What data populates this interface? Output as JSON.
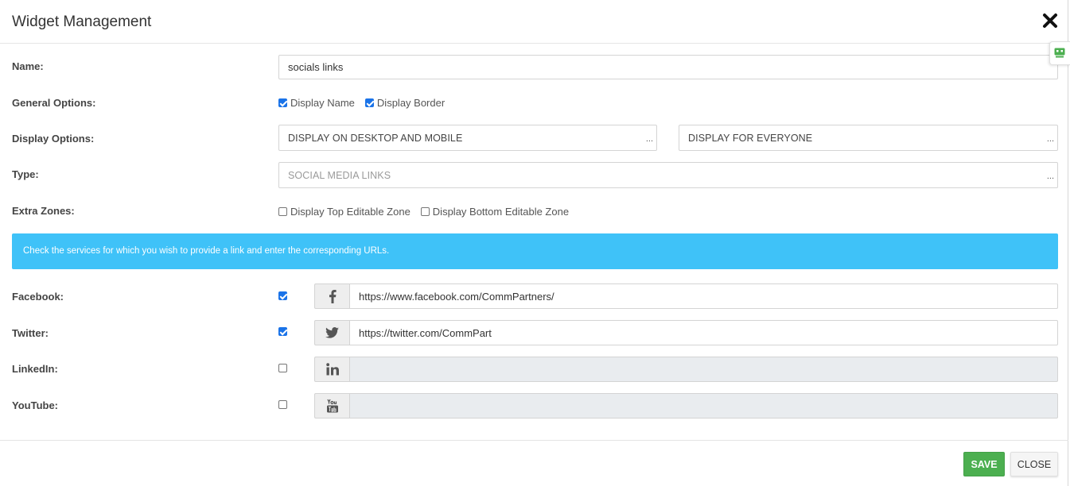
{
  "dialog": {
    "title": "Widget Management"
  },
  "form": {
    "name_label": "Name:",
    "name_value": "socials links",
    "general_label": "General Options:",
    "general_options": [
      {
        "label": "Display Name",
        "checked": true
      },
      {
        "label": "Display Border",
        "checked": true
      }
    ],
    "display_label": "Display Options:",
    "display_device": "DISPLAY ON DESKTOP AND MOBILE",
    "display_audience": "DISPLAY FOR EVERYONE",
    "type_label": "Type:",
    "type_value": "SOCIAL MEDIA LINKS",
    "extra_label": "Extra Zones:",
    "extra_zones": [
      {
        "label": "Display Top Editable Zone",
        "checked": false
      },
      {
        "label": "Display Bottom Editable Zone",
        "checked": false
      }
    ],
    "dots": "..."
  },
  "info": {
    "message": "Check the services for which you wish to provide a link and enter the corresponding URLs."
  },
  "socials": [
    {
      "label": "Facebook:",
      "checked": true,
      "icon": "facebook-icon",
      "url": "https://www.facebook.com/CommPartners/"
    },
    {
      "label": "Twitter:",
      "checked": true,
      "icon": "twitter-icon",
      "url": "https://twitter.com/CommPart"
    },
    {
      "label": "LinkedIn:",
      "checked": false,
      "icon": "linkedin-icon",
      "url": ""
    },
    {
      "label": "YouTube:",
      "checked": false,
      "icon": "youtube-icon",
      "url": ""
    }
  ],
  "footer": {
    "save_label": "SAVE",
    "close_label": "CLOSE"
  },
  "colors": {
    "info_bg": "#3fc2f8",
    "save_bg": "#4caf50",
    "checkbox": "#1a73e8"
  }
}
